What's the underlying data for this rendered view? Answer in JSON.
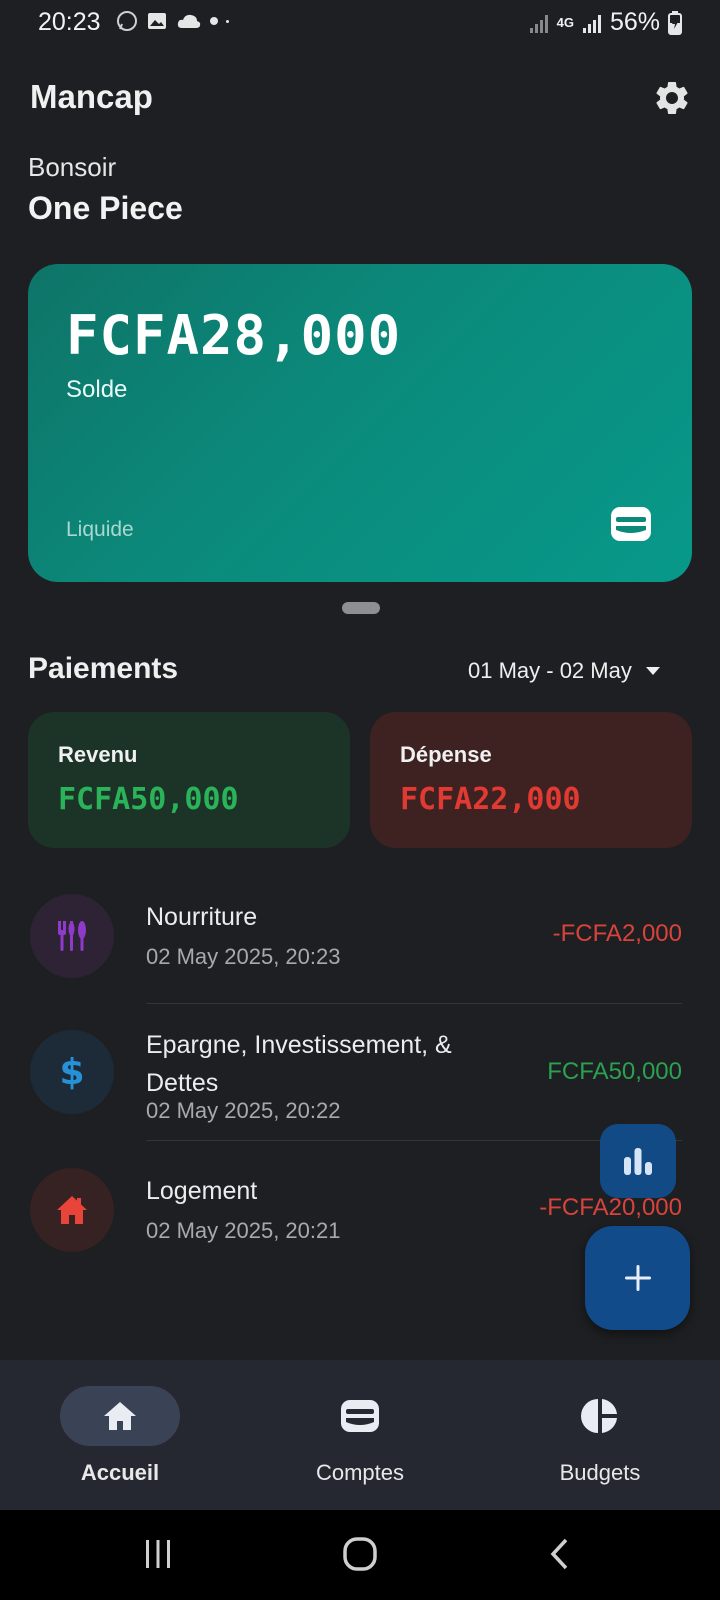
{
  "status_bar": {
    "time": "20:23",
    "battery": "56%",
    "network": "4G",
    "icons": [
      "whatsapp-icon",
      "gallery-icon",
      "cloud-icon",
      "notification-dot-icon",
      "signal-icon",
      "battery-charging-icon"
    ]
  },
  "header": {
    "app_title": "Mancap",
    "settings_icon": "gear-icon"
  },
  "greeting": {
    "salutation": "Bonsoir",
    "user_name": "One Piece"
  },
  "balance_card": {
    "amount": "FCFA28,000",
    "label": "Solde",
    "account_type": "Liquide",
    "icon": "wallet-icon",
    "colors": {
      "gradient_start": "#0e7468",
      "gradient_end": "#07998a"
    }
  },
  "payments": {
    "title": "Paiements",
    "date_range": "01 May - 02 May",
    "income": {
      "label": "Revenu",
      "amount": "FCFA50,000",
      "color": "#2bb35a"
    },
    "expense": {
      "label": "Dépense",
      "amount": "FCFA22,000",
      "color": "#e03a33"
    }
  },
  "transactions": [
    {
      "name": "Nourriture",
      "date": "02 May 2025, 20:23",
      "amount": "-FCFA2,000",
      "icon": "fork-knife-icon",
      "icon_color": "#8e3bc7"
    },
    {
      "name": "Epargne, Investissement, & Dettes",
      "date": "02 May 2025, 20:22",
      "amount": "FCFA50,000",
      "icon": "dollar-icon",
      "icon_color": "#2690d8"
    },
    {
      "name": "Logement",
      "date": "02 May 2025, 20:21",
      "amount": "-FCFA20,000",
      "icon": "house-icon",
      "icon_color": "#e8443a"
    }
  ],
  "fabs": {
    "stats_icon": "bar-chart-icon",
    "add_icon": "plus-icon"
  },
  "bottom_nav": {
    "items": [
      {
        "label": "Accueil",
        "icon": "home-icon",
        "active": true
      },
      {
        "label": "Comptes",
        "icon": "wallet-icon",
        "active": false
      },
      {
        "label": "Budgets",
        "icon": "pie-chart-icon",
        "active": false
      }
    ]
  },
  "system_nav": {
    "icons": [
      "recent-apps-icon",
      "home-circle-icon",
      "back-icon"
    ]
  }
}
